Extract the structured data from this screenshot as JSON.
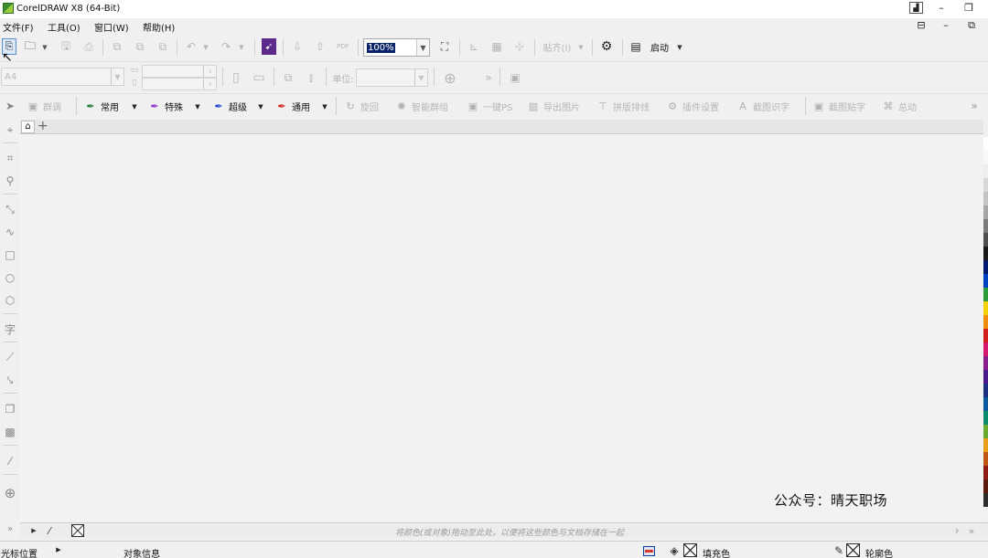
{
  "window": {
    "title": "CorelDRAW X8 (64-Bit)",
    "buttons": [
      "▁",
      "❐",
      "▣"
    ]
  },
  "menu": {
    "items": [
      "文件(F)",
      "工具(O)",
      "窗口(W)",
      "帮助(H)"
    ],
    "right_buttons": [
      "⊟",
      "—",
      "⧉"
    ]
  },
  "standard_toolbar": {
    "zoom": {
      "value": "100%"
    },
    "snap_label": "贴齐(I)",
    "launch_label": "启动",
    "pdf_label": "PDF"
  },
  "property_bar": {
    "units_label": "单位:",
    "page_size_value": "A4",
    "overflow": "»"
  },
  "plugin_toolbar": {
    "items": [
      {
        "label": "群调",
        "icon": "palette-icon",
        "color": "#b0b0b0",
        "active": false
      },
      {
        "label": "常用",
        "icon": "pen-icon",
        "color": "#1c7a2f",
        "active": true
      },
      {
        "label": "特殊",
        "icon": "pen-icon",
        "color": "#8b2fc9",
        "active": true
      },
      {
        "label": "超级",
        "icon": "pen-icon",
        "color": "#1f3fd1",
        "active": true
      },
      {
        "label": "通用",
        "icon": "pen-icon",
        "color": "#d0221c",
        "active": true
      },
      {
        "label": "旋回",
        "icon": "rotate-icon",
        "color": "#b0b0b0",
        "active": false
      },
      {
        "label": "智能群组",
        "icon": "sparkle-icon",
        "color": "#b0b0b0",
        "active": false
      },
      {
        "label": "一键PS",
        "icon": "image-icon",
        "color": "#b0b0b0",
        "active": false
      },
      {
        "label": "导出图片",
        "icon": "picture-icon",
        "color": "#b0b0b0",
        "active": false
      },
      {
        "label": "拼版排线",
        "icon": "grid-icon",
        "color": "#b0b0b0",
        "active": false
      },
      {
        "label": "插件设置",
        "icon": "gear-icon",
        "color": "#b0b0b0",
        "active": false
      },
      {
        "label": "截图识字",
        "icon": "text-scan-icon",
        "color": "#b0b0b0",
        "active": false
      },
      {
        "label": "截图贴字",
        "icon": "clip-icon",
        "color": "#b0b0b0",
        "active": false
      },
      {
        "label": "总动",
        "icon": "group-icon",
        "color": "#b0b0b0",
        "active": false
      }
    ],
    "overflow": "»"
  },
  "canvas": {
    "watermark": "公众号：晴天职场"
  },
  "palette": {
    "colors": [
      "#ffffff",
      "#f8f8f8",
      "#eeeeee",
      "#d8d8d8",
      "#c4c4c4",
      "#a6a6a6",
      "#7a7a7a",
      "#4e4e4e",
      "#1a1a1a",
      "#001a6e",
      "#0042c4",
      "#2c9d3a",
      "#f4d10a",
      "#f28e0c",
      "#d1201b",
      "#d51a6d",
      "#8a1d8c",
      "#4b1b8b",
      "#1d2f80",
      "#0a5a9c",
      "#0a8a6e",
      "#6aaa2e",
      "#e7a017",
      "#c25714",
      "#8d1c15",
      "#5c1a0c",
      "#2b2b2b"
    ]
  },
  "doc_palette": {
    "hint": "将颜色(或对象)拖动至此处，以便将这些颜色与文档存储在一起"
  },
  "status": {
    "cursor_label": "光标位置",
    "object_label": "对象信息",
    "fill_label": "填充色",
    "outline_label": "轮廓色"
  }
}
